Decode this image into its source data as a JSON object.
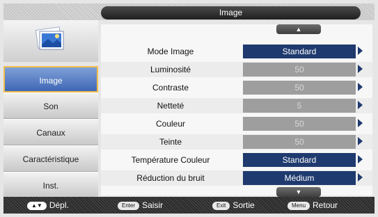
{
  "title": "Image",
  "sidebar": {
    "items": [
      {
        "label": "Image",
        "active": true
      },
      {
        "label": "Son",
        "active": false
      },
      {
        "label": "Canaux",
        "active": false
      },
      {
        "label": "Caractéristique",
        "active": false
      },
      {
        "label": "Inst.",
        "active": false
      }
    ]
  },
  "main": {
    "up_arrow": "▲",
    "down_arrow": "▼",
    "rows": [
      {
        "label": "Mode Image",
        "value": "Standard",
        "kind": "sel"
      },
      {
        "label": "Luminosité",
        "value": "50",
        "kind": "num"
      },
      {
        "label": "Contraste",
        "value": "50",
        "kind": "num"
      },
      {
        "label": "Netteté",
        "value": "5",
        "kind": "num"
      },
      {
        "label": "Couleur",
        "value": "50",
        "kind": "num"
      },
      {
        "label": "Teinte",
        "value": "50",
        "kind": "num"
      },
      {
        "label": "Température Couleur",
        "value": "Standard",
        "kind": "sel"
      },
      {
        "label": "Réduction du bruit",
        "value": "Médium",
        "kind": "sel"
      }
    ]
  },
  "footer": {
    "move_key": "▲▼",
    "move_label": "Dépl.",
    "enter_key": "Enter",
    "enter_label": "Saisir",
    "exit_key": "Exit",
    "exit_label": "Sortie",
    "menu_key": "Menu",
    "menu_label": "Retour"
  },
  "colors": {
    "selected_value": "#1f3a6e",
    "active_tab": "#3f67b5",
    "active_border": "#f2c04b"
  },
  "icons": {
    "logo": "photo-icon",
    "chevron": "chevron-right-icon"
  }
}
